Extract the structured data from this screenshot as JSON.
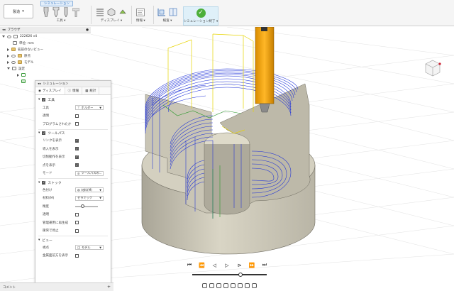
{
  "toolbar": {
    "workspace": "製造",
    "active_tab": "シミュレーション",
    "groups": {
      "tools": "工具",
      "display": "ディスプレイ",
      "info": "情報",
      "inspect": "検査",
      "finish": "シミュレーション終了"
    }
  },
  "browser": {
    "title": "ブラウザ",
    "items": [
      "222626 v4",
      "単位: mm",
      "名前のないビュー",
      "原点",
      "モデル",
      "設定"
    ]
  },
  "simulation": {
    "title": "シミュレーション",
    "tabs": [
      "ディスプレイ",
      "情報",
      "統計"
    ],
    "sections": {
      "tool": {
        "label": "工具",
        "rows": [
          {
            "label": "工具",
            "value": "ホルダー"
          },
          {
            "label": "透明"
          },
          {
            "label": "プログラムされたか"
          }
        ]
      },
      "toolpath": {
        "label": "ツールパス",
        "rows": [
          {
            "label": "リンクを表示"
          },
          {
            "label": "導入を表示"
          },
          {
            "label": "切削動作を表示"
          },
          {
            "label": "点を表示"
          },
          {
            "label": "モード",
            "value": "ツールパスの..."
          }
        ]
      },
      "stock": {
        "label": "ストック",
        "rows": [
          {
            "label": "色付け",
            "value": "材料(M)"
          },
          {
            "label": "材料(M)",
            "value": "セラミック"
          },
          {
            "label": "精度",
            "level": 0.3
          },
          {
            "label": "透明"
          },
          {
            "label": "管理運用に再生成"
          },
          {
            "label": "衝突で停止"
          }
        ]
      },
      "view": {
        "label": "ビュー",
        "rows": [
          {
            "label": "視点",
            "value": "モデル"
          },
          {
            "label": "金属面前方を表示"
          }
        ]
      }
    }
  },
  "playback": {
    "position": 0.66
  },
  "comments": {
    "label": "コメント"
  }
}
